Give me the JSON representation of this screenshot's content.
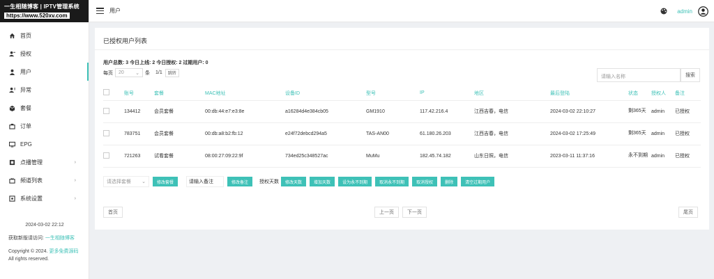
{
  "logo": {
    "line1": "一生相随博客 | IPTV管理系统",
    "line2": "https://www.520xv.com"
  },
  "sidebar": {
    "items": [
      {
        "label": "首页",
        "icon": "home-icon"
      },
      {
        "label": "授权",
        "icon": "user-key-icon"
      },
      {
        "label": "用户",
        "icon": "user-icon"
      },
      {
        "label": "异常",
        "icon": "user-alert-icon"
      },
      {
        "label": "套餐",
        "icon": "package-icon"
      },
      {
        "label": "订单",
        "icon": "order-icon"
      },
      {
        "label": "EPG",
        "icon": "tv-icon"
      },
      {
        "label": "点播管理",
        "icon": "film-icon"
      },
      {
        "label": "频道列表",
        "icon": "channel-icon"
      },
      {
        "label": "系统设置",
        "icon": "settings-icon"
      }
    ],
    "footer_time": "2024-03-02 22:12",
    "footer_link_prefix": "获取新版请访问:",
    "footer_link": "一生相随博客",
    "copyright": "Copyright © 2024.",
    "copyright_link": "更多免费源码",
    "rights": "All rights reserved."
  },
  "header": {
    "crumb": "用户",
    "user": "admin"
  },
  "card": {
    "title": "已授权用户列表",
    "stats": "用户总数: 3 今日上线: 2 今日授权: 2 过期用户: 0",
    "per_page_label": "每页",
    "per_page_value": "20",
    "per_page_unit": "条",
    "page_info": "1/1",
    "jump_label": "跳转",
    "search_placeholder": "请输入名称",
    "search_button": "搜索"
  },
  "table": {
    "headers": [
      "账号",
      "套餐",
      "MAC地址",
      "设备ID",
      "型号",
      "IP",
      "地区",
      "最后登陆",
      "状态",
      "授权人",
      "备注"
    ],
    "rows": [
      [
        "134412",
        "会员套餐",
        "00:db:44:e7:e3:8e",
        "a16284d4e384cb05",
        "GM1910",
        "117.42.216.4",
        "江西吉春，电信",
        "2024-03-02 22:10:27",
        "剩365天",
        "admin",
        "已授权"
      ],
      [
        "783751",
        "会员套餐",
        "00:db:a8:b2:fb:12",
        "e24f72debcd294a5",
        "TAS-AN00",
        "61.180.26.203",
        "江西吉春，电信",
        "2024-03-02 17:25:49",
        "剩365天",
        "admin",
        "已授权"
      ],
      [
        "721263",
        "试看套餐",
        "08:00:27:09:22:9f",
        "734ed25c348527ac",
        "MuMu",
        "182.45.74.182",
        "山东日照，电信",
        "2023-03-11 11:37:16",
        "永不到期",
        "admin",
        "已授权"
      ]
    ]
  },
  "actions": {
    "select_package": "请选择套餐",
    "modify_package": "修改套餐",
    "note_placeholder": "请输入备注",
    "modify_note": "修改备注",
    "days_label": "授权天数",
    "modify_days": "修改天数",
    "add_days": "增加天数",
    "set_never_expire": "设为永不到期",
    "cancel_never_expire": "取消永不到期",
    "cancel_auth": "取消授权",
    "delete": "删除",
    "clear_expired": "清空过期用户"
  },
  "pagination": {
    "first": "首页",
    "prev": "上一页",
    "next": "下一页",
    "last": "尾页"
  },
  "colors": {
    "accent": "#3ec1b7",
    "logo_bg": "#1a1a1a"
  }
}
